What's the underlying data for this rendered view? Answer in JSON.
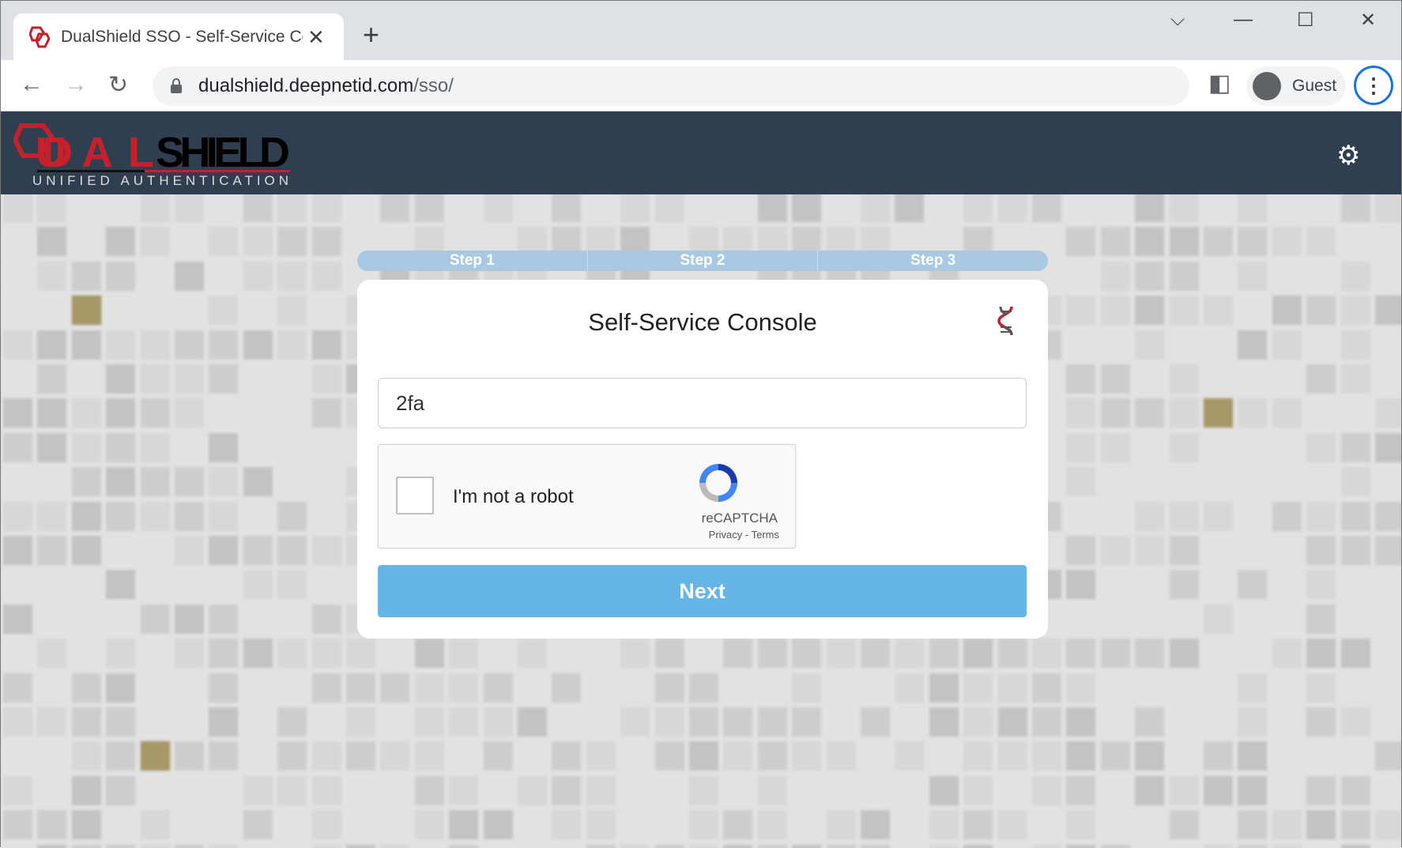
{
  "browser": {
    "tab_title": "DualShield SSO - Self-Service Console",
    "url_host": "dualshield.deepnetid.com",
    "url_path": "/sso/",
    "profile": "Guest"
  },
  "header": {
    "logo_text": "DUALSHIELD",
    "logo_sub": "UNIFIED AUTHENTICATION"
  },
  "steps": [
    "Step 1",
    "Step 2",
    "Step 3"
  ],
  "card": {
    "title": "Self-Service Console",
    "input_value": "2fa",
    "captcha_label": "I'm not a robot",
    "captcha_brand": "reCAPTCHA",
    "captcha_privacy": "Privacy",
    "captcha_sep": " - ",
    "captcha_terms": "Terms",
    "next_label": "Next"
  },
  "colors": {
    "header": "#2f3f4f",
    "accent": "#65b6e6",
    "brand_red": "#c8202b"
  }
}
